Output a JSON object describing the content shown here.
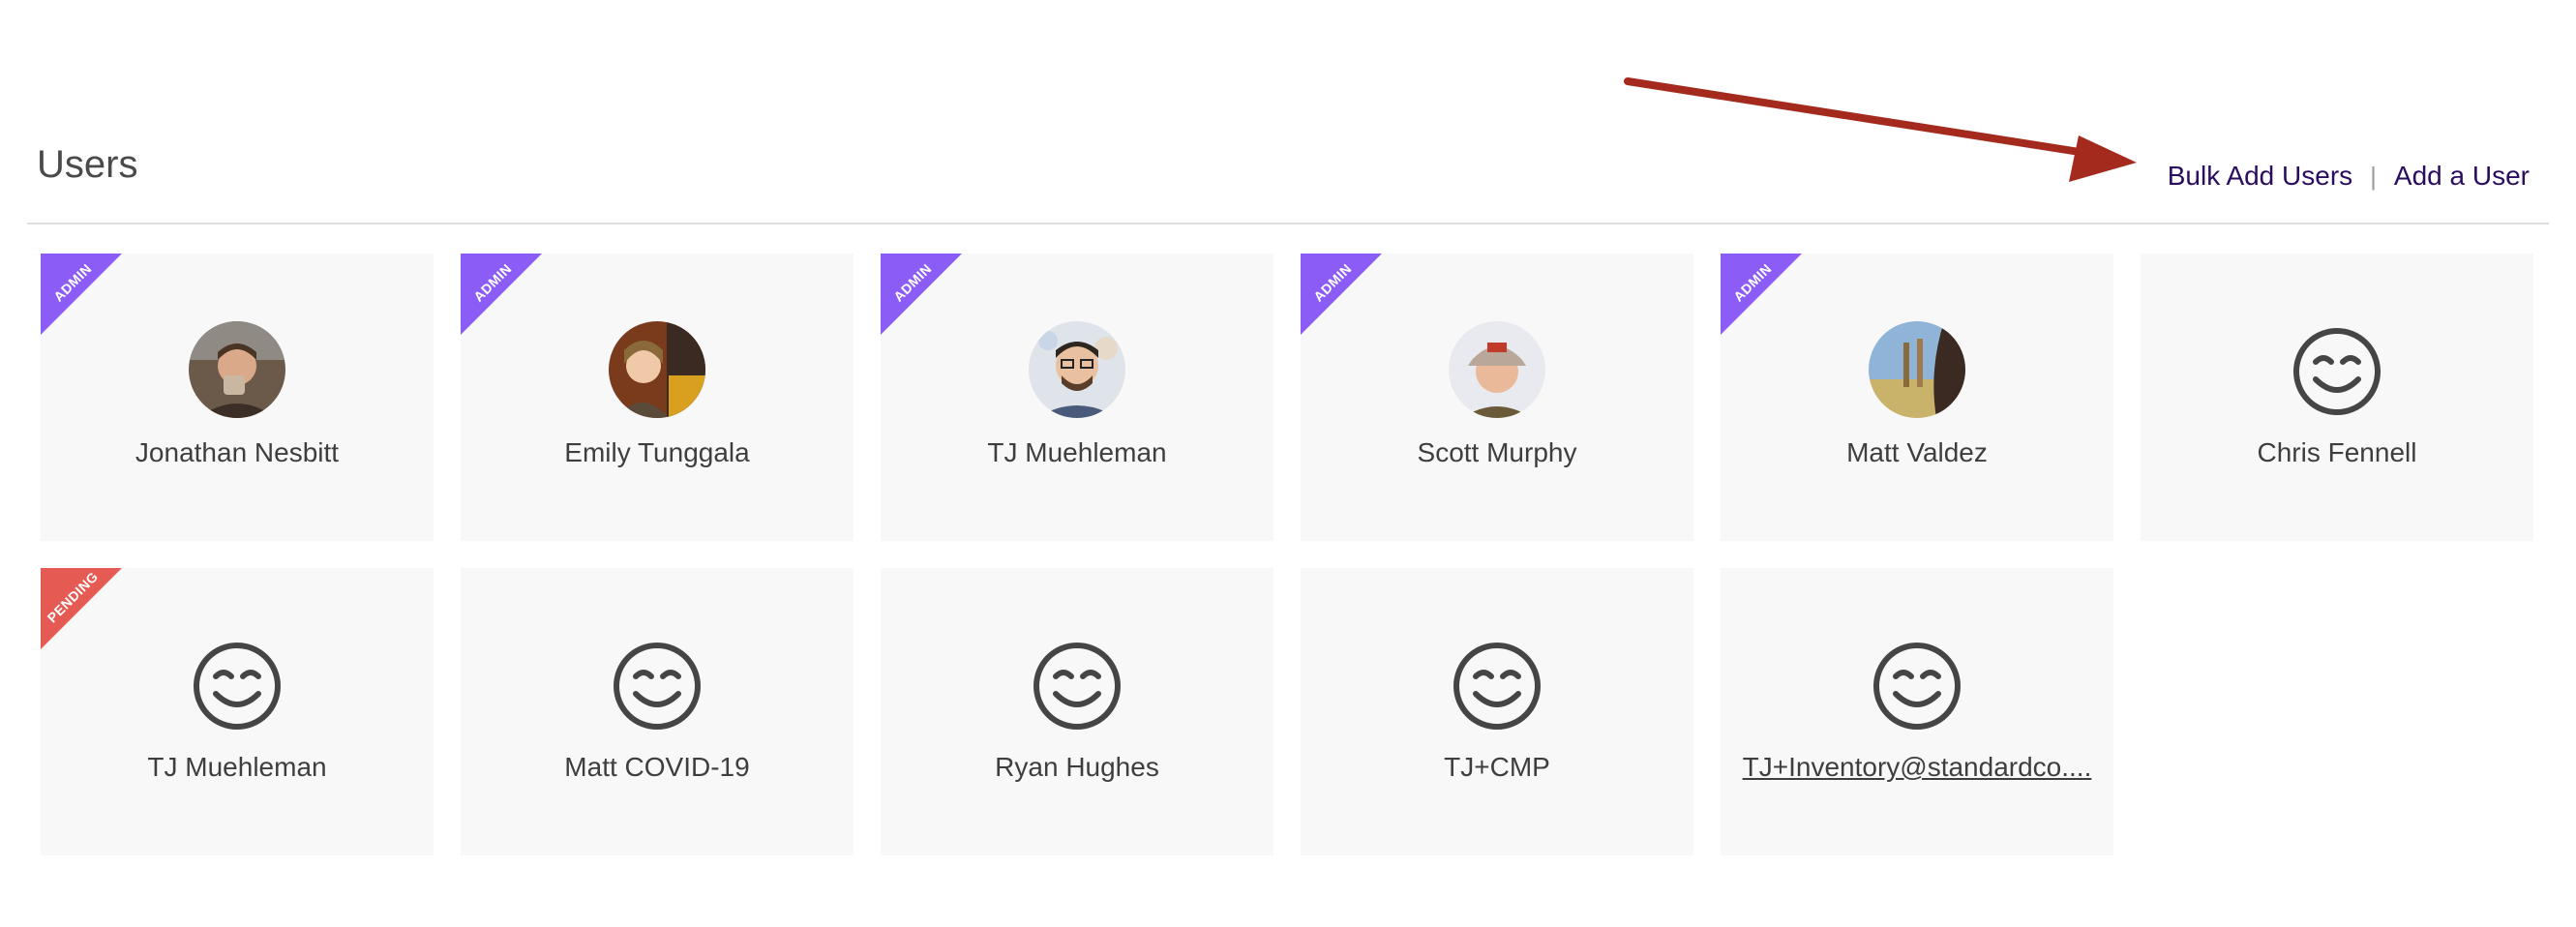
{
  "page": {
    "title": "Users",
    "actions": {
      "bulk_add": "Bulk Add Users",
      "separator": "|",
      "add_user": "Add a User"
    }
  },
  "annotation": {
    "type": "arrow",
    "color": "#a52a1e"
  },
  "badges": {
    "admin": "ADMIN",
    "pending": "PENDING"
  },
  "colors": {
    "admin_ribbon": "#8b5cf6",
    "pending_ribbon": "#e55a52",
    "link": "#2a0d5e"
  },
  "users": [
    {
      "name": "Jonathan Nesbitt",
      "badge": "admin",
      "avatar": "photo"
    },
    {
      "name": "Emily Tunggala",
      "badge": "admin",
      "avatar": "photo"
    },
    {
      "name": "TJ Muehleman",
      "badge": "admin",
      "avatar": "photo"
    },
    {
      "name": "Scott Murphy",
      "badge": "admin",
      "avatar": "photo"
    },
    {
      "name": "Matt Valdez",
      "badge": "admin",
      "avatar": "photo"
    },
    {
      "name": "Chris Fennell",
      "badge": "",
      "avatar": "smiley-icon"
    },
    {
      "name": "TJ Muehleman",
      "badge": "pending",
      "avatar": "smiley-icon"
    },
    {
      "name": "Matt COVID-19",
      "badge": "",
      "avatar": "smiley-icon"
    },
    {
      "name": "Ryan Hughes",
      "badge": "",
      "avatar": "smiley-icon"
    },
    {
      "name": "TJ+CMP",
      "badge": "",
      "avatar": "smiley-icon"
    },
    {
      "name": "TJ+Inventory@standardco....",
      "badge": "",
      "avatar": "smiley-icon",
      "link": true
    }
  ]
}
